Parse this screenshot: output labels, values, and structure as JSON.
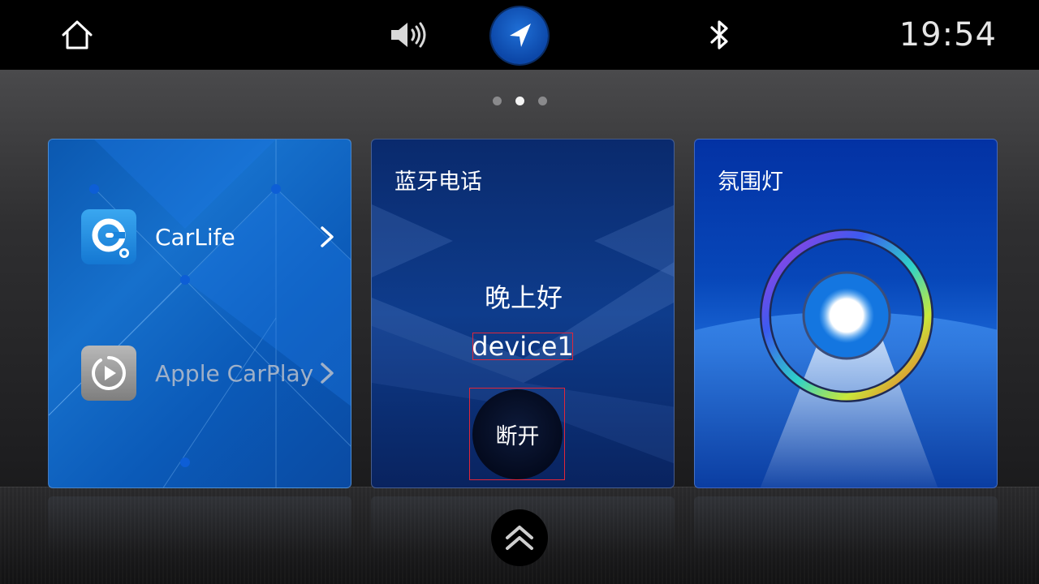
{
  "topbar": {
    "clock": "19:54",
    "icons": [
      "home-icon",
      "volume-icon",
      "navigation-icon",
      "bluetooth-icon"
    ]
  },
  "pager": {
    "count": 3,
    "active": 1
  },
  "cards": {
    "apps": {
      "items": [
        {
          "label": "CarLife",
          "icon": "carlife-icon",
          "enabled": true
        },
        {
          "label": "Apple CarPlay",
          "icon": "carplay-icon",
          "enabled": false
        }
      ]
    },
    "bluetooth_phone": {
      "title": "蓝牙电话",
      "greeting": "晚上好",
      "device": "device1",
      "disconnect_label": "断开"
    },
    "ambient_light": {
      "title": "氛围灯"
    }
  },
  "colors": {
    "accent_blue": "#0c47a8",
    "highlight_border": "#e0263a"
  }
}
